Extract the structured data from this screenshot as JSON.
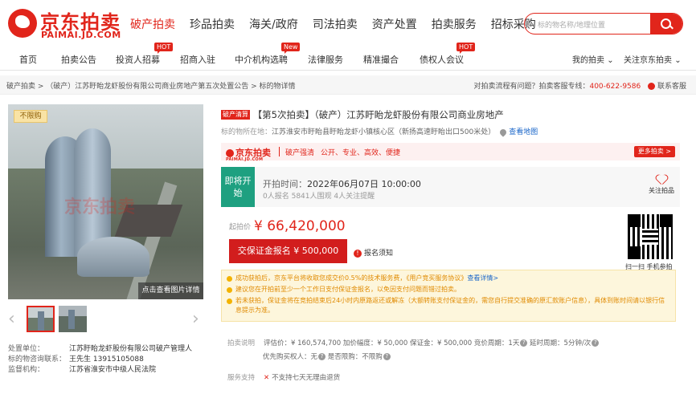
{
  "header": {
    "logo_cn": "京东拍卖",
    "logo_en": "PAIMAI.JD.COM",
    "nav": [
      "破产拍卖",
      "珍品拍卖",
      "海关/政府",
      "司法拍卖",
      "资产处置",
      "拍卖服务",
      "招标采购"
    ],
    "active_nav": "破产拍卖",
    "search_placeholder": "标的物名称/地理位置"
  },
  "subnav": {
    "items": [
      "首页",
      "拍卖公告",
      "投资人招募",
      "招商入驻",
      "中介机构选聘",
      "法律服务",
      "精准撮合",
      "债权人会议"
    ],
    "badges": {
      "hot1": "HOT",
      "new": "New",
      "hot2": "HOT"
    },
    "my_auction": "我的拍卖",
    "follow_jd": "关注京东拍卖"
  },
  "breadcrumb": {
    "path": "破产拍卖 > （破产）江苏盱眙龙虾股份有限公司商业房地产第五次处置公告 > 标的物详情",
    "help": "对拍卖流程有问题？拍卖客服专线：",
    "phone": "400-622-9586",
    "contact": "联系客服"
  },
  "gallery": {
    "badge": "不限购",
    "watermark": "京东拍卖",
    "view_all": "点击查看图片详情"
  },
  "meta": {
    "disposal_label": "处置单位：",
    "disposal_value": "江苏盱眙龙虾股份有限公司破产管理人",
    "contact_label": "标的物咨询联系：",
    "contact_value": "王先生 13915105088",
    "supervisor_label": "监督机构：",
    "supervisor_value": "江苏省淮安市中级人民法院"
  },
  "item": {
    "tag": "破产清算",
    "title": "【第5次拍卖】（破产）江苏盱眙龙虾股份有限公司商业房地产",
    "loc_label": "标的物所在地：",
    "loc_value": "江苏淮安市盱眙县盱眙龙虾小镇核心区（新扬高速盱眙出口500米处）",
    "map": "查看地图"
  },
  "banner": {
    "logo": "京东拍卖",
    "logo_en": "PAIMAI.JD.COM",
    "t1": "破产强清",
    "t2": "公开、专业、高效、便捷",
    "more": "更多拍卖 >"
  },
  "status": {
    "state": "即将开始",
    "time_label": "开拍时间：",
    "time_value": "2022年06月07日 10:00:00",
    "counts": "0人报名  5841人围观  4人关注提醒",
    "follow": "关注拍品"
  },
  "price": {
    "label": "起拍价",
    "value": "¥ 66,420,000",
    "pay_button": "交保证金报名 ¥ 500,000",
    "notice": "报名须知",
    "qr_label": "扫一扫 手机参拍"
  },
  "tips": {
    "t1a": "成功获拍后，京东平台将收取您成交价0.5%的技术服务费，《用户竞买服务协议》",
    "t1b": "查看详情>",
    "t2": "建议您在开拍前至少一个工作日支付保证金报名，以免因支付问题而错过拍卖。",
    "t3": "若未获拍，保证金将在竞拍结束后24小时内原路返还或解冻（大额转账支付保证金的，需您自行提交准确的原汇款账户信息），具体到账时间请以银行信息提示为准。"
  },
  "info": {
    "label": "拍卖说明",
    "line1": "评估价：¥ 160,574,700    加价幅度：¥ 50,000    保证金：¥ 500,000    竞价周期：1天",
    "delay": "   延时周期：5分钟/次",
    "line2a": "优先购买权人：无",
    "line2b": "   是否限购：不限购"
  },
  "service": {
    "label": "服务支持",
    "text": "不支持七天无理由退货"
  }
}
